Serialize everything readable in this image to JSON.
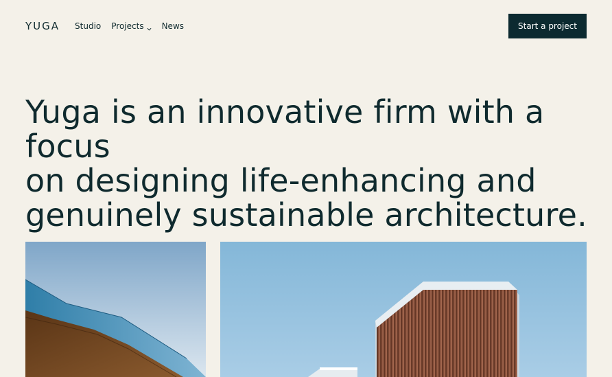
{
  "brand": {
    "logo": "YUGA"
  },
  "nav": {
    "items": [
      {
        "label": "Studio"
      },
      {
        "label": "Projects",
        "icon": "chevron-down-icon"
      },
      {
        "label": "News"
      }
    ]
  },
  "header": {
    "cta_label": "Start a project"
  },
  "hero": {
    "line1": "Yuga is an innovative firm with a focus",
    "line2": "on designing life-enhancing and",
    "line3": "genuinely sustainable architecture."
  },
  "colors": {
    "background": "#f4f1e9",
    "text": "#0f2a2e",
    "cta": "#0c2a30"
  }
}
